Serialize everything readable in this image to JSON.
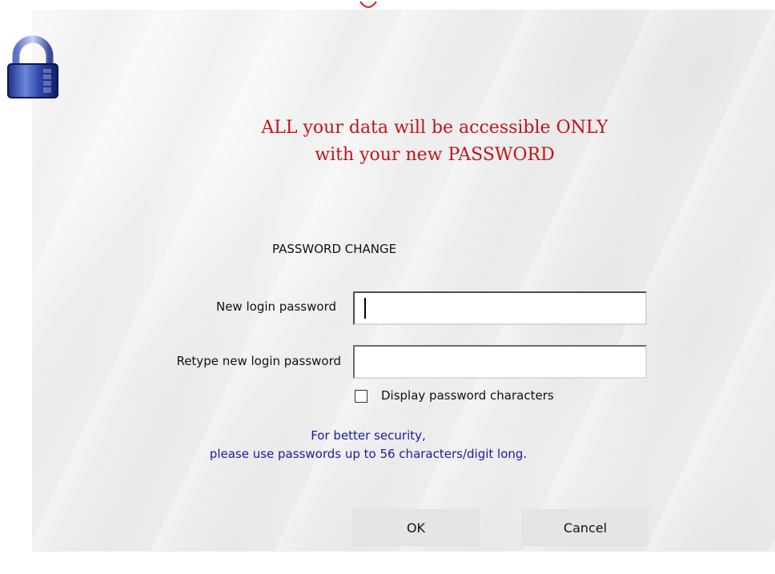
{
  "dialog": {
    "headline": {
      "line1": "ALL your data will be accessible ONLY",
      "line2": "with your new PASSWORD"
    },
    "section_title": "PASSWORD CHANGE",
    "fields": {
      "new_password": {
        "label": "New login password",
        "value": ""
      },
      "retype_password": {
        "label": "Retype new login password",
        "value": ""
      }
    },
    "display_checkbox": {
      "label": "Display password characters",
      "checked": false
    },
    "hint": {
      "line1": "For better security,",
      "line2": "please use passwords up to 56 characters/digit long."
    },
    "buttons": {
      "ok": "OK",
      "cancel": "Cancel"
    }
  },
  "icons": {
    "lock": "lock-icon"
  },
  "colors": {
    "headline": "#c4121a",
    "hint": "#1b1b9a",
    "button_bg": "#e5e5e5"
  }
}
